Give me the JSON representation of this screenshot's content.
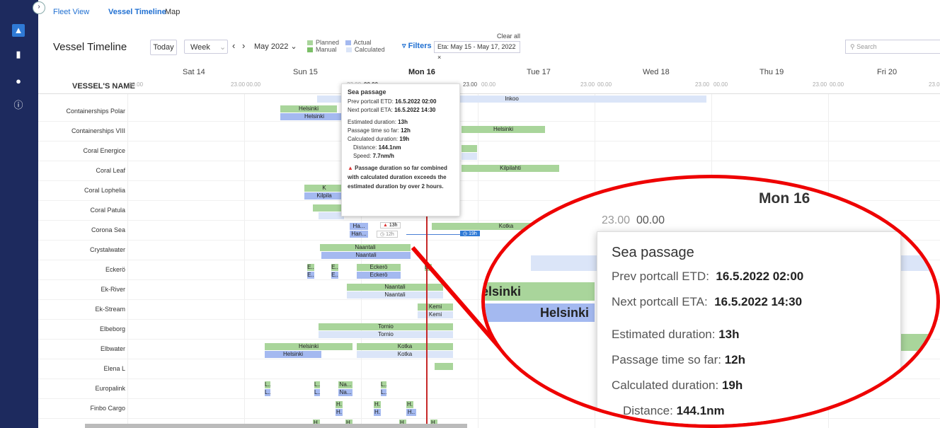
{
  "nav": {
    "fleet_view": "Fleet View",
    "vessel_timeline": "Vessel Timeline",
    "map": "Map"
  },
  "toolbar": {
    "title": "Vessel Timeline",
    "today": "Today",
    "period": "Week",
    "month": "May 2022",
    "legend_planned": "Planned",
    "legend_actual": "Actual",
    "legend_manual": "Manual",
    "legend_calculated": "Calculated",
    "filters": "Filters",
    "filter_chip": "Eta: May 15 - May 17, 2022 ×",
    "clear_all": "Clear all",
    "search_placeholder": "Search"
  },
  "colors": {
    "planned": "#a9d59b",
    "actual": "#a4b9f0",
    "calculated": "#dbe5f8",
    "now_line": "#c62828",
    "accent": "#1f6fd1"
  },
  "timeline": {
    "vessel_header": "VESSEL'S NAME",
    "days": [
      "Sat 14",
      "Sun 15",
      "Mon 16",
      "Tue 17",
      "Wed 18",
      "Thu 19",
      "Fri 20"
    ],
    "times": {
      "start": "00.00",
      "end": "23.00"
    },
    "vessels": [
      "Containerships Polar",
      "Containerships VIII",
      "Coral Energice",
      "Coral Leaf",
      "Coral Lophelia",
      "Coral Patula",
      "Corona Sea",
      "Crystalwater",
      "Eckerö",
      "Ek-River",
      "Ek-Stream",
      "Elbeborg",
      "Elbwater",
      "Elena L",
      "Europalink",
      "Finbo Cargo"
    ],
    "bar_labels": {
      "inkoo": "Inkoo",
      "helsinki": "Helsinki",
      "kilpilahti": "Kilpilahti",
      "kotka": "Kotka",
      "naantali": "Naantali",
      "eckero": "Eckerö",
      "kemi": "Kemi",
      "tornio": "Tornio",
      "ha_short": "Ha...",
      "han_short": "Han...",
      "e_short": "E..",
      "l_short": "L..",
      "na_short": "Na...",
      "h_short": "H..",
      "h": "H.",
      "k": "K",
      "kilpila": "Kilpila",
      "ec_short": "E..."
    },
    "corona_badges": {
      "estimated": "13h",
      "so_far": "12h",
      "calculated": "19h"
    }
  },
  "tooltip": {
    "title": "Sea passage",
    "prev_label": "Prev portcall ETD:",
    "prev_value": "16.5.2022 02:00",
    "next_label": "Next portcall ETA:",
    "next_value": "16.5.2022 14:30",
    "est_label": "Estimated duration:",
    "est_value": "13h",
    "sofar_label": "Passage time so far:",
    "sofar_value": "12h",
    "calc_label": "Calculated duration:",
    "calc_value": "19h",
    "distance_label": "Distance:",
    "distance_value": "144.1nm",
    "speed_label": "Speed:",
    "speed_value": "7.7nm/h",
    "warning": "Passage duration so far combined with calculated duration exceeds the estimated duration by over 2 hours."
  },
  "zoom": {
    "day": "Mon 16",
    "time_a": "23.00",
    "time_b": "00.00",
    "time_c": "23.00",
    "bar1": "elsinki",
    "bar2": "Helsinki"
  }
}
